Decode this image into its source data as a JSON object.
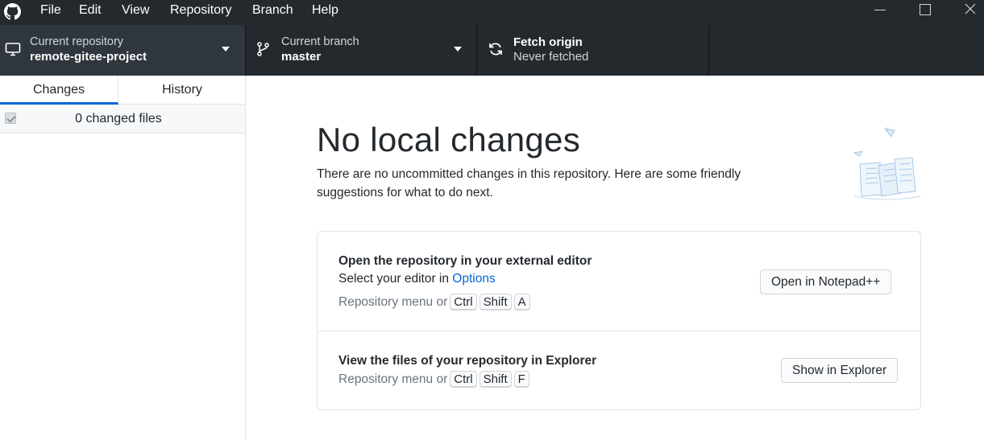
{
  "menu": {
    "items": [
      "File",
      "Edit",
      "View",
      "Repository",
      "Branch",
      "Help"
    ]
  },
  "toolbar": {
    "repository": {
      "label": "Current repository",
      "value": "remote-gitee-project"
    },
    "branch": {
      "label": "Current branch",
      "value": "master"
    },
    "fetch": {
      "title": "Fetch origin",
      "status": "Never fetched"
    }
  },
  "sidebar": {
    "tabs": [
      "Changes",
      "History"
    ],
    "active_tab": "Changes",
    "changed_files": "0 changed files"
  },
  "main": {
    "title": "No local changes",
    "description": "There are no uncommitted changes in this repository. Here are some friendly suggestions for what to do next.",
    "actions": [
      {
        "title": "Open the repository in your external editor",
        "text_prefix": "Select your editor in ",
        "link": "Options",
        "hint_prefix": "Repository menu or",
        "keys": [
          "Ctrl",
          "Shift",
          "A"
        ],
        "button": "Open in Notepad++"
      },
      {
        "title": "View the files of your repository in Explorer",
        "hint_prefix": "Repository menu or",
        "keys": [
          "Ctrl",
          "Shift",
          "F"
        ],
        "button": "Show in Explorer"
      }
    ]
  },
  "colors": {
    "titlebar": "#24292e",
    "toolbar_active": "#2f363d",
    "accent": "#0366d6",
    "muted_text": "#6a737d"
  },
  "icons": [
    "github-logo-icon",
    "minimize-icon",
    "maximize-icon",
    "close-icon",
    "computer-icon",
    "branch-icon",
    "sync-icon",
    "caret-down-icon"
  ]
}
